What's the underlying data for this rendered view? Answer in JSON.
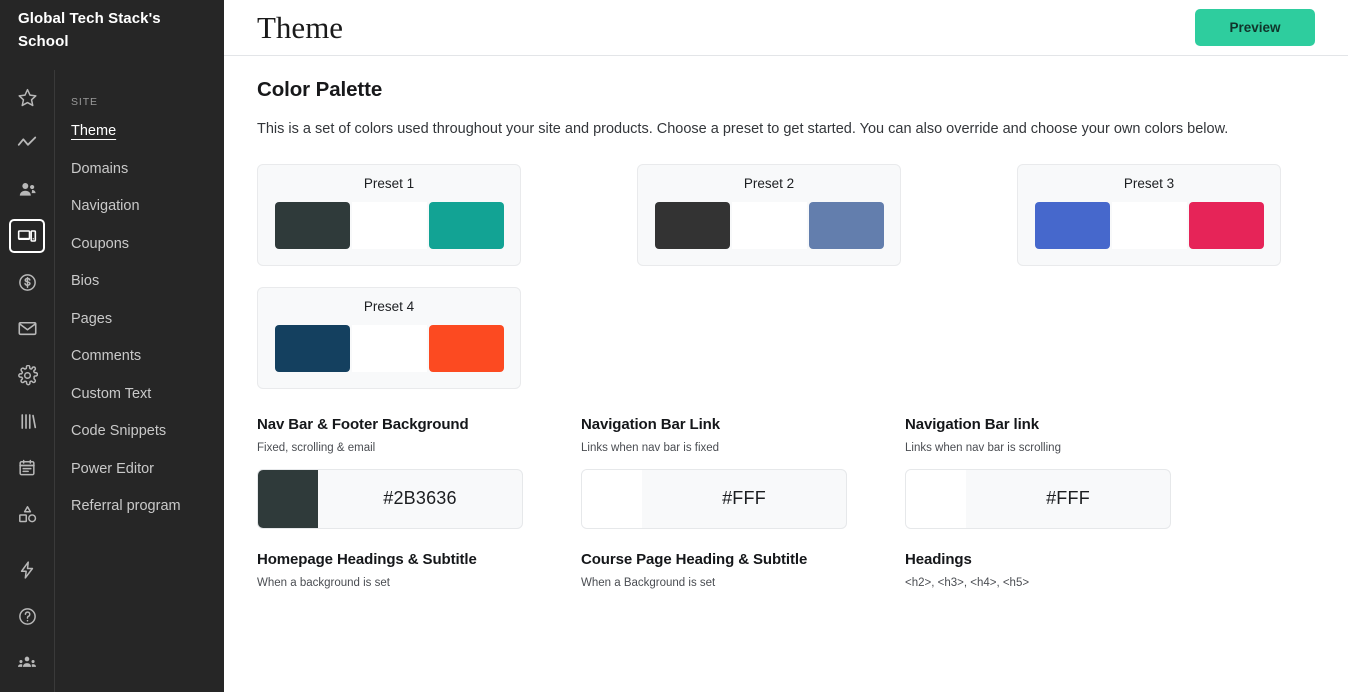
{
  "sidebar": {
    "brand": "Global Tech Stack's School",
    "rail_icons": [
      {
        "name": "star-icon"
      },
      {
        "name": "analytics-line-icon"
      },
      {
        "name": "users-icon"
      },
      {
        "name": "site-devices-icon",
        "active": true
      },
      {
        "name": "dollar-circle-icon"
      },
      {
        "name": "envelope-icon"
      },
      {
        "name": "gear-icon"
      },
      {
        "name": "books-icon"
      },
      {
        "name": "clipboard-icon"
      },
      {
        "name": "shapes-icon"
      }
    ],
    "rail_icons_bottom": [
      {
        "name": "lightning-bolt-icon"
      },
      {
        "name": "help-circle-icon"
      },
      {
        "name": "community-group-icon"
      }
    ],
    "section_label": "SITE",
    "items": [
      {
        "label": "Theme",
        "active": true
      },
      {
        "label": "Domains",
        "active": false
      },
      {
        "label": "Navigation",
        "active": false
      },
      {
        "label": "Coupons",
        "active": false
      },
      {
        "label": "Bios",
        "active": false
      },
      {
        "label": "Pages",
        "active": false
      },
      {
        "label": "Comments",
        "active": false
      },
      {
        "label": "Custom Text",
        "active": false
      },
      {
        "label": "Code Snippets",
        "active": false
      },
      {
        "label": "Power Editor",
        "active": false
      },
      {
        "label": "Referral program",
        "active": false
      }
    ]
  },
  "topbar": {
    "title": "Theme",
    "preview_label": "Preview",
    "preview_color": "#2ECD9E"
  },
  "palette": {
    "heading": "Color Palette",
    "description": "This is a set of colors used throughout your site and products. Choose a preset to get started. You can also override and choose your own colors below.",
    "presets": [
      {
        "name": "Preset 1",
        "colors": [
          "#2F3A3A",
          "#FFFFFF",
          "#12A394"
        ]
      },
      {
        "name": "Preset 2",
        "colors": [
          "#333333",
          "#FFFFFF",
          "#637EAD"
        ]
      },
      {
        "name": "Preset 3",
        "colors": [
          "#4668CC",
          "#FFFFFF",
          "#E62458"
        ]
      },
      {
        "name": "Preset 4",
        "colors": [
          "#14405F",
          "#FC4A21",
          "#FFFFFF"
        ]
      }
    ]
  },
  "fields": [
    {
      "label": "Nav Bar & Footer Background",
      "hint": "Fixed, scrolling & email",
      "value": "#2B3636",
      "swatch": "#2F3A3A"
    },
    {
      "label": "Navigation Bar Link",
      "hint": "Links when nav bar is fixed",
      "value": "#FFF",
      "swatch": "#FFFFFF"
    },
    {
      "label": "Navigation Bar link",
      "hint": "Links when nav bar is scrolling",
      "value": "#FFF",
      "swatch": "#FFFFFF"
    }
  ],
  "fields_bottom": [
    {
      "label": "Homepage Headings & Subtitle",
      "hint": "When a background is set"
    },
    {
      "label": "Course Page Heading & Subtitle",
      "hint": "When a Background is set"
    },
    {
      "label": "Headings",
      "hint": "<h2>, <h3>, <h4>, <h5>"
    }
  ]
}
